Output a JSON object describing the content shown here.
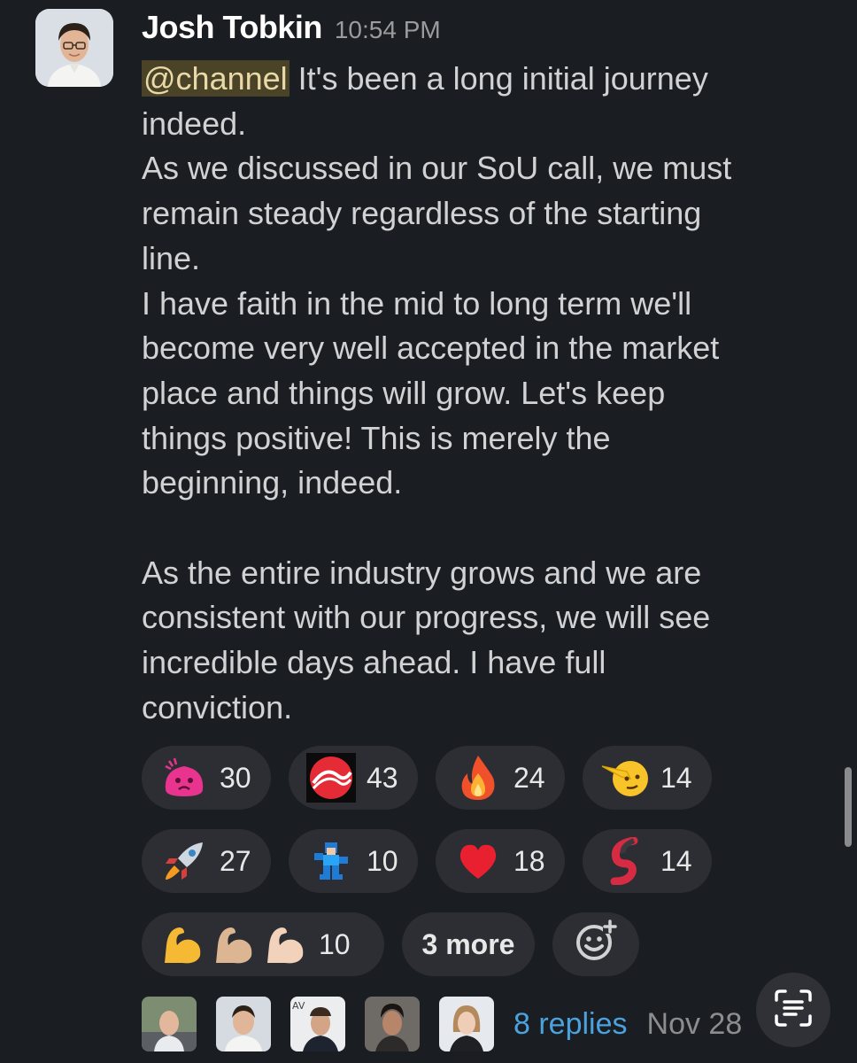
{
  "message": {
    "author": "Josh Tobkin",
    "time": "10:54 PM",
    "mention": "@channel",
    "lines": [
      " It's been a long initial journey",
      "indeed.",
      "As we discussed in our SoU call, we must",
      "remain steady regardless of the starting",
      "line.",
      "I have faith in the mid to long term we'll",
      "become very well accepted in the market",
      "place and things will grow. Let's keep",
      "things positive! This is merely the",
      "beginning, indeed.",
      "",
      "As the entire industry grows and we are",
      "consistent with our progress, we will see",
      "incredible days ahead. I have full",
      "conviction."
    ]
  },
  "reactions": [
    {
      "icon": "pink-blob-crying-emoji",
      "count": "30"
    },
    {
      "icon": "red-swirl-logo-emoji",
      "count": "43"
    },
    {
      "icon": "fire-emoji",
      "count": "24"
    },
    {
      "icon": "saluting-face-emoji",
      "count": "14"
    },
    {
      "icon": "rocket-emoji",
      "count": "27"
    },
    {
      "icon": "megaman-pixel-emoji",
      "count": "10"
    },
    {
      "icon": "red-heart-emoji",
      "count": "18"
    },
    {
      "icon": "red-s-logo-emoji",
      "count": "14"
    },
    {
      "icon": "flexed-biceps-emoji",
      "count": "10"
    }
  ],
  "more_label": "3 more",
  "replies": {
    "label": "8 replies",
    "date": "Nov 28",
    "avatars": [
      "replier-avatar-1",
      "replier-avatar-2",
      "replier-avatar-3",
      "replier-avatar-4",
      "replier-avatar-5"
    ]
  },
  "colors": {
    "background": "#1a1d21",
    "pill": "#2c2e33",
    "mention_bg": "#4b4328",
    "link": "#4aa3df"
  }
}
